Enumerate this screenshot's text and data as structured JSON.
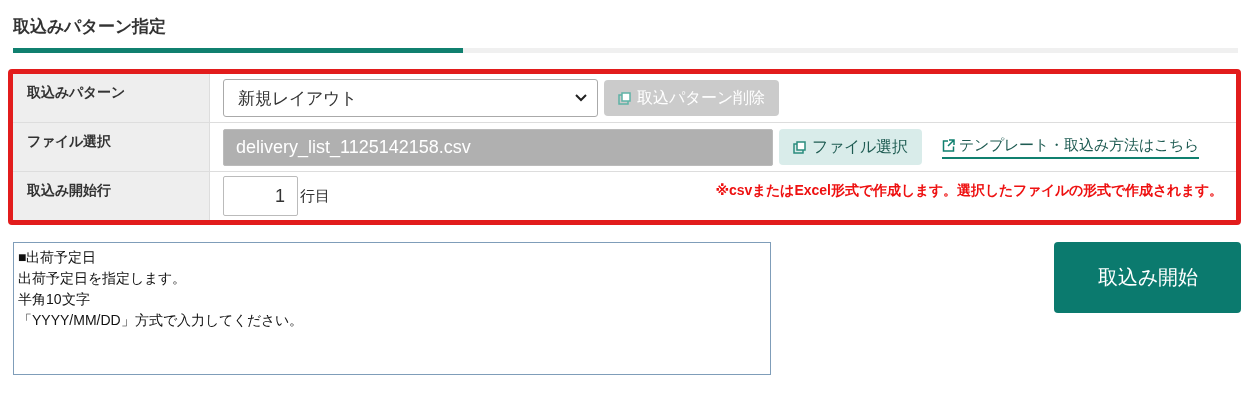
{
  "section_title": "取込みパターン指定",
  "form": {
    "rows": [
      {
        "kind": "pattern",
        "label": "取込みパターン",
        "select": {
          "value": "新規レイアウト"
        },
        "button": {
          "label": "取込パターン削除",
          "disabled": true
        }
      },
      {
        "kind": "file",
        "label": "ファイル選択",
        "field": {
          "value": "delivery_list_1125142158.csv",
          "disabled": true
        },
        "button": {
          "label": "ファイル選択",
          "disabled": false
        },
        "link": "テンプレート・取込み方法はこちら"
      },
      {
        "kind": "start_row",
        "label": "取込み開始行",
        "field": {
          "value": "1",
          "disabled": false
        },
        "unit": "行目",
        "note": "※csvまたはExcel形式で作成します。選択したファイルの形式で作成されます。"
      }
    ]
  },
  "help_box": {
    "lines": [
      "■出荷予定日",
      "出荷予定日を指定します。",
      "半角10文字",
      "「YYYY/MM/DD」方式で入力してください。"
    ]
  },
  "start_button": {
    "label": "取込み開始"
  }
}
